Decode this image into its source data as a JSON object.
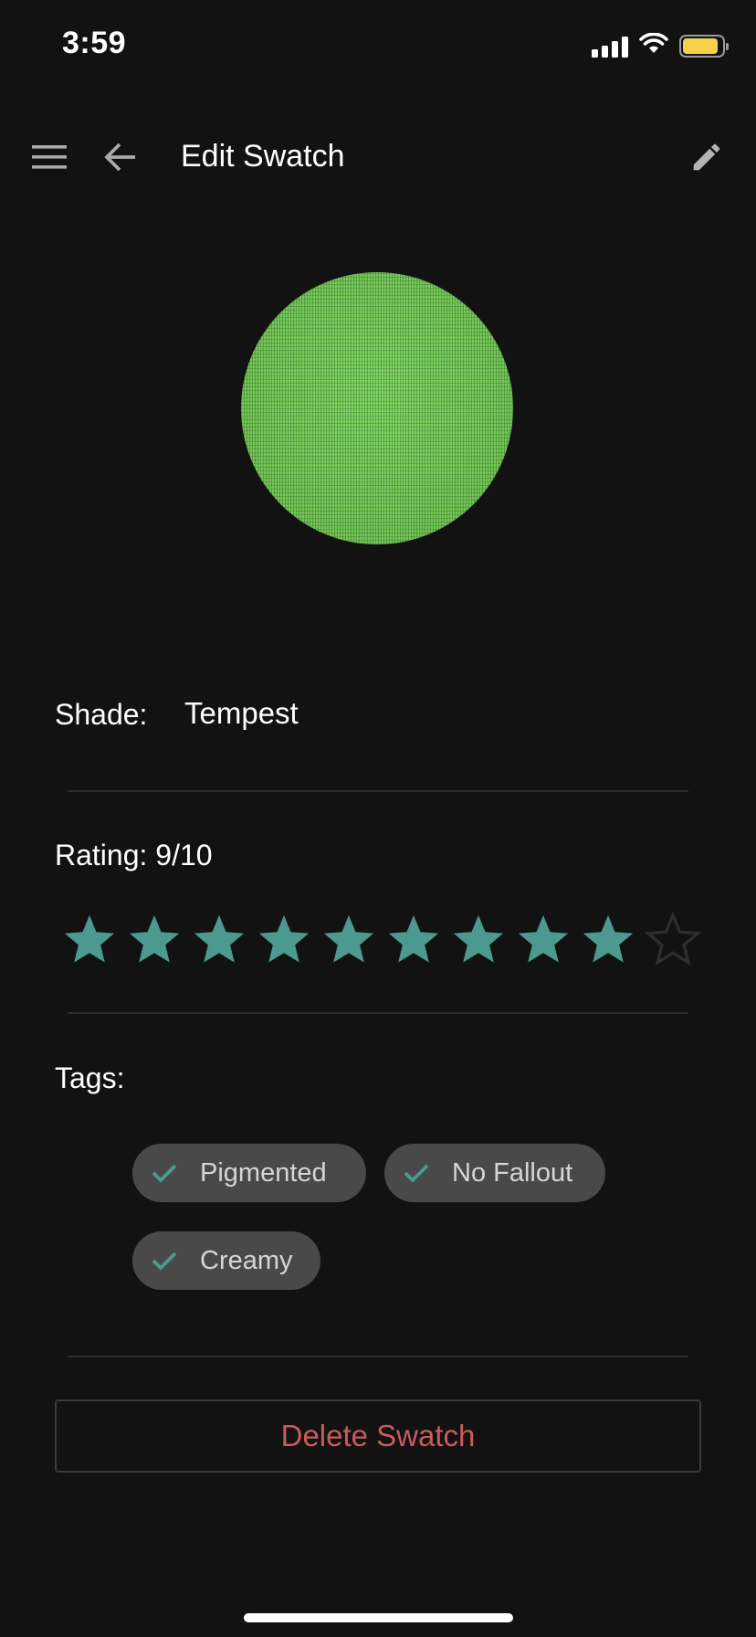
{
  "status_bar": {
    "time": "3:59",
    "battery_level": 0.9,
    "battery_color": "#f5d14b"
  },
  "app_bar": {
    "title": "Edit Swatch",
    "icons": [
      "menu-icon",
      "arrow-left-icon",
      "pencil-icon"
    ]
  },
  "swatch": {
    "color": "#7fd35f"
  },
  "shade": {
    "label": "Shade:",
    "value": "Tempest"
  },
  "rating": {
    "label": "Rating: 9/10",
    "value": 9,
    "max": 10,
    "filled_color": "#4c9a8f",
    "empty_color": "#2e2e2e"
  },
  "tags": {
    "label": "Tags:",
    "items": [
      "Pigmented",
      "No Fallout",
      "Creamy"
    ],
    "check_color": "#4c9a8f"
  },
  "actions": {
    "delete_label": "Delete Swatch",
    "delete_color": "#c95b5b"
  }
}
